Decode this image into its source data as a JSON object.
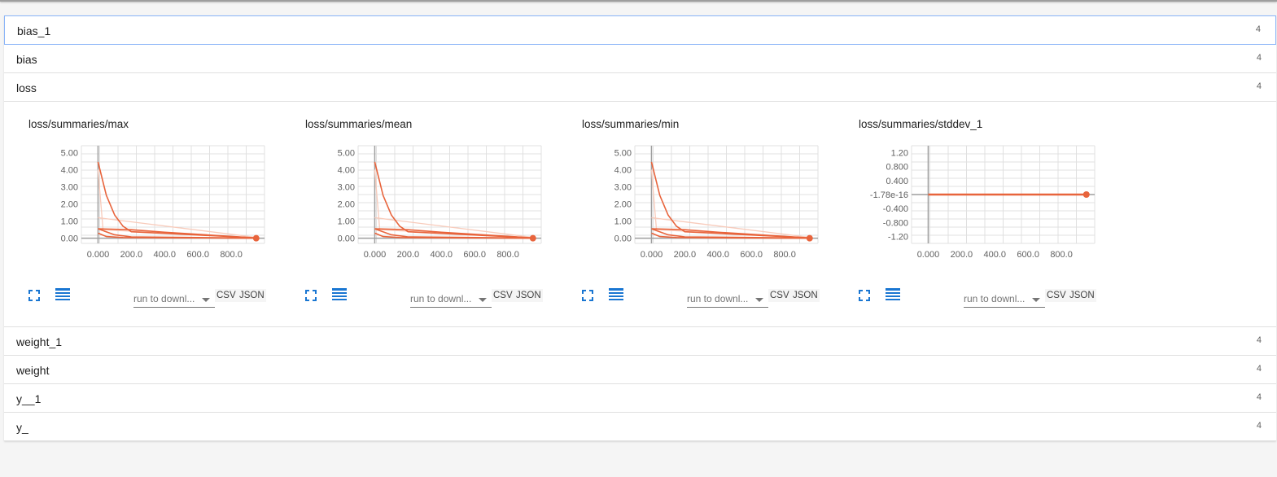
{
  "categories_above": [
    {
      "name": "bias_1",
      "count": "4"
    },
    {
      "name": "bias",
      "count": "4"
    },
    {
      "name": "loss",
      "count": "4"
    }
  ],
  "categories_below": [
    {
      "name": "weight_1",
      "count": "4"
    },
    {
      "name": "weight",
      "count": "4"
    },
    {
      "name": "y__1",
      "count": "4"
    },
    {
      "name": "y_",
      "count": "4"
    }
  ],
  "controls": {
    "download_select": "run to downl...",
    "csv_label": "CSV",
    "json_label": "JSON",
    "expand_icon": "fullscreen-icon",
    "log_icon": "data-table-icon"
  },
  "colors": {
    "series": "#e8643c",
    "series_faint": "#f8cbbb",
    "axis": "#9e9e9e",
    "grid": "#e0e0e0",
    "accent": "#1976d2"
  },
  "chart_data": [
    {
      "type": "line",
      "title": "loss/summaries/max",
      "xlim": [
        -100,
        1000
      ],
      "ylim": [
        -0.3,
        5.4
      ],
      "x_ticks": [
        "0.000",
        "200.0",
        "400.0",
        "600.0",
        "800.0"
      ],
      "y_ticks": [
        "0.00",
        "1.00",
        "2.00",
        "3.00",
        "4.00",
        "5.00"
      ],
      "series": [
        {
          "x": [
            0,
            50,
            100,
            150,
            200,
            950
          ],
          "y": [
            4.45,
            2.5,
            1.35,
            0.7,
            0.38,
            0.02
          ]
        },
        {
          "x": [
            0,
            100,
            200,
            950
          ],
          "y": [
            0.55,
            0.2,
            0.08,
            0.01
          ]
        },
        {
          "x": [
            0,
            200,
            400,
            950
          ],
          "y": [
            0.55,
            0.5,
            0.35,
            0.02
          ]
        },
        {
          "x": [
            0,
            50,
            150,
            950
          ],
          "y": [
            0.3,
            0.1,
            0.04,
            0.0
          ]
        }
      ],
      "faint_series": [
        {
          "x": [
            0,
            950
          ],
          "y": [
            1.2,
            0.05
          ]
        },
        {
          "x": [
            0,
            30,
            950
          ],
          "y": [
            4.0,
            0.5,
            0.02
          ]
        }
      ],
      "last_point": {
        "x": 950,
        "y": 0.0
      }
    },
    {
      "type": "line",
      "title": "loss/summaries/mean",
      "xlim": [
        -100,
        1000
      ],
      "ylim": [
        -0.3,
        5.4
      ],
      "x_ticks": [
        "0.000",
        "200.0",
        "400.0",
        "600.0",
        "800.0"
      ],
      "y_ticks": [
        "0.00",
        "1.00",
        "2.00",
        "3.00",
        "4.00",
        "5.00"
      ],
      "series": [
        {
          "x": [
            0,
            50,
            100,
            150,
            200,
            950
          ],
          "y": [
            4.45,
            2.5,
            1.35,
            0.7,
            0.38,
            0.02
          ]
        },
        {
          "x": [
            0,
            100,
            200,
            950
          ],
          "y": [
            0.55,
            0.2,
            0.08,
            0.01
          ]
        },
        {
          "x": [
            0,
            200,
            400,
            950
          ],
          "y": [
            0.55,
            0.5,
            0.35,
            0.02
          ]
        },
        {
          "x": [
            0,
            50,
            150,
            950
          ],
          "y": [
            0.3,
            0.1,
            0.04,
            0.0
          ]
        }
      ],
      "faint_series": [
        {
          "x": [
            0,
            950
          ],
          "y": [
            1.2,
            0.05
          ]
        },
        {
          "x": [
            0,
            30,
            950
          ],
          "y": [
            4.0,
            0.5,
            0.02
          ]
        }
      ],
      "last_point": {
        "x": 950,
        "y": 0.0
      }
    },
    {
      "type": "line",
      "title": "loss/summaries/min",
      "xlim": [
        -100,
        1000
      ],
      "ylim": [
        -0.3,
        5.4
      ],
      "x_ticks": [
        "0.000",
        "200.0",
        "400.0",
        "600.0",
        "800.0"
      ],
      "y_ticks": [
        "0.00",
        "1.00",
        "2.00",
        "3.00",
        "4.00",
        "5.00"
      ],
      "series": [
        {
          "x": [
            0,
            50,
            100,
            150,
            200,
            950
          ],
          "y": [
            4.45,
            2.5,
            1.35,
            0.7,
            0.38,
            0.02
          ]
        },
        {
          "x": [
            0,
            100,
            200,
            950
          ],
          "y": [
            0.55,
            0.2,
            0.08,
            0.01
          ]
        },
        {
          "x": [
            0,
            200,
            400,
            950
          ],
          "y": [
            0.55,
            0.5,
            0.35,
            0.02
          ]
        },
        {
          "x": [
            0,
            50,
            150,
            950
          ],
          "y": [
            0.3,
            0.1,
            0.04,
            0.0
          ]
        }
      ],
      "faint_series": [
        {
          "x": [
            0,
            950
          ],
          "y": [
            1.2,
            0.05
          ]
        },
        {
          "x": [
            0,
            30,
            950
          ],
          "y": [
            4.0,
            0.5,
            0.02
          ]
        }
      ],
      "last_point": {
        "x": 950,
        "y": 0.0
      }
    },
    {
      "type": "line",
      "title": "loss/summaries/stddev_1",
      "xlim": [
        -100,
        1000
      ],
      "ylim": [
        -1.4,
        1.4
      ],
      "x_ticks": [
        "0.000",
        "200.0",
        "400.0",
        "600.0",
        "800.0"
      ],
      "y_ticks": [
        "-1.20",
        "-0.800",
        "-0.400",
        "-1.78e-16",
        "0.400",
        "0.800",
        "1.20"
      ],
      "series": [
        {
          "x": [
            0,
            950
          ],
          "y": [
            0,
            0
          ]
        }
      ],
      "faint_series": [],
      "last_point": {
        "x": 950,
        "y": 0
      }
    }
  ]
}
